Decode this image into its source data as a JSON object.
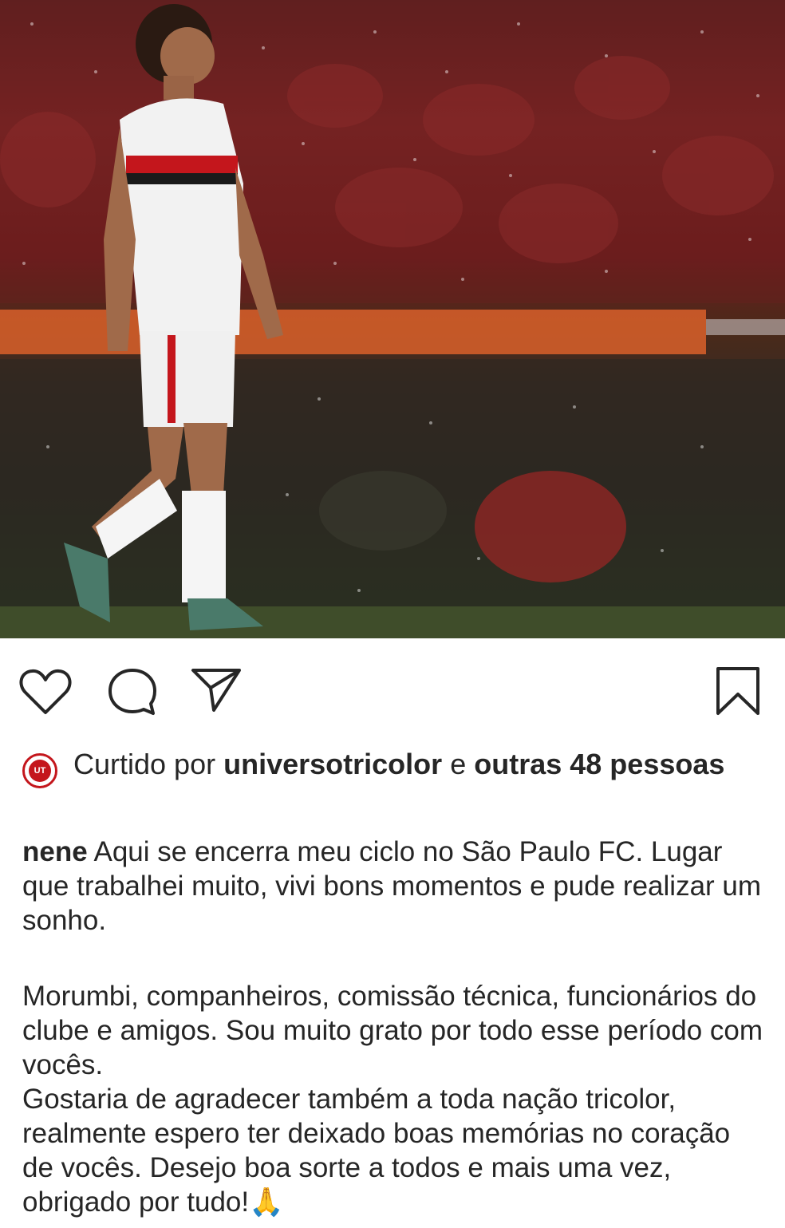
{
  "post": {
    "photo_alt": "football-player-in-rain",
    "actions": {
      "like_icon": "heart-icon",
      "comment_icon": "comment-bubble-icon",
      "share_icon": "paper-plane-icon",
      "save_icon": "bookmark-icon"
    },
    "likes": {
      "prefix": "Curtido por",
      "user": "universotricolor",
      "connector": "e",
      "others": "outras 48 pessoas",
      "avatar_text": "UT"
    },
    "caption": {
      "username": "nene",
      "paragraph1": "Aqui se encerra meu ciclo no São Paulo FC. Lugar que trabalhei muito, vivi bons momentos e pude realizar um sonho.",
      "paragraph2": "Morumbi, companheiros, comissão técnica, funcionários do clube e amigos. Sou muito grato por todo esse período com vocês.",
      "paragraph3": "Gostaria de agradecer também a toda nação tricolor, realmente espero ter deixado boas memórias no coração de vocês. Desejo boa sorte a todos e mais uma vez, obrigado por tudo!🙏"
    }
  },
  "colors": {
    "text": "#262626",
    "club_red": "#c4161c"
  }
}
